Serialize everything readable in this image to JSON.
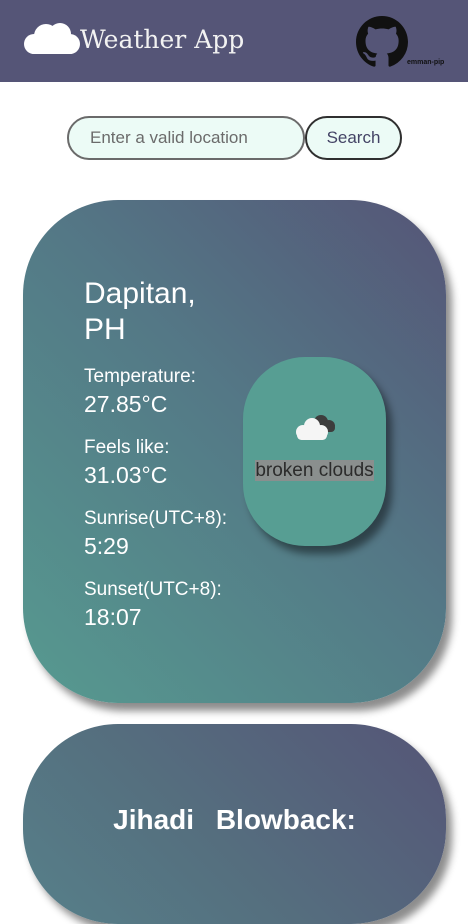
{
  "header": {
    "app_title": "Weather App",
    "logo_icon": "cloud-icon",
    "github_icon": "github-icon",
    "github_user": "emman-pip",
    "background": "#555577"
  },
  "search": {
    "placeholder": "Enter a valid location",
    "value": "",
    "button_label": "Search"
  },
  "weather_card": {
    "city": "Dapitan, PH",
    "temperature_label": "Temperature:",
    "temperature_value": "27.85°C",
    "feels_like_label": "Feels like:",
    "feels_like_value": "31.03°C",
    "sunrise_label": "Sunrise(UTC+8):",
    "sunrise_value": "5:29",
    "sunset_label": "Sunset(UTC+8):",
    "sunset_value": "18:07",
    "condition_icon": "broken-clouds-icon",
    "condition": "broken clouds"
  },
  "second_card": {
    "title": "Jihadi Blowback:"
  },
  "colors": {
    "card_gradient_start": "#555577",
    "card_gradient_end": "#569a90",
    "condition_box": "#579e93",
    "input_bg": "#ecfbf6"
  }
}
